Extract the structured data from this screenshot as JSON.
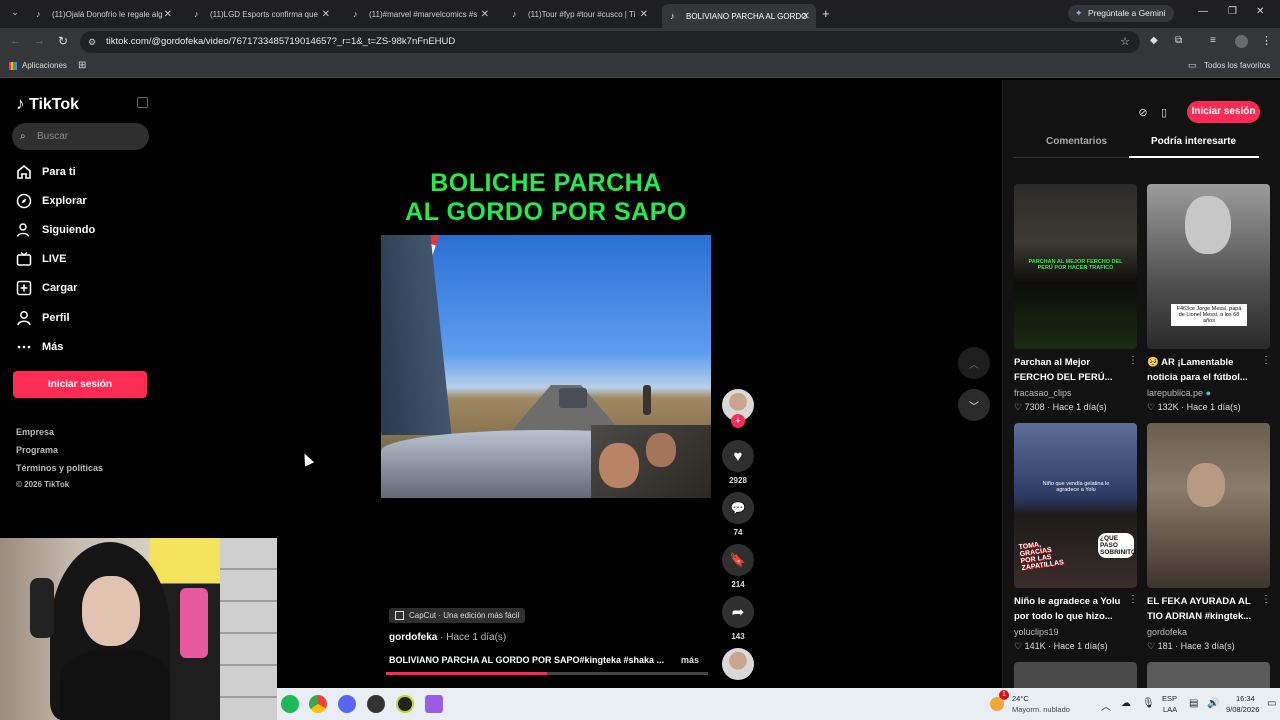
{
  "browser": {
    "tabs": [
      {
        "title": "(11)Ojalá Donofrio le regale alg",
        "active": false
      },
      {
        "title": "(11)LGD Esports confirma que",
        "active": false
      },
      {
        "title": "(11)#marvel #marvelcomics #s",
        "active": false
      },
      {
        "title": "(11)Tour #fyp #tour #cusco | Ti",
        "active": false
      },
      {
        "title": "BOLIVIANO PARCHA AL GORDO",
        "active": true
      }
    ],
    "new_tab": "+",
    "gemini_button": "Pregúntale a Gemini",
    "url": "tiktok.com/@gordofeka/video/7671733485719014657?_r=1&_t=ZS-98k7nFnEHUD",
    "bookmarks": {
      "apps": "Aplicaciones",
      "all": "Todos los favoritos"
    }
  },
  "sidebar": {
    "logo": "TikTok",
    "search_placeholder": "Buscar",
    "nav": [
      {
        "label": "Para ti",
        "icon": "home-icon"
      },
      {
        "label": "Explorar",
        "icon": "compass-icon"
      },
      {
        "label": "Siguiendo",
        "icon": "following-icon"
      },
      {
        "label": "LIVE",
        "icon": "live-icon"
      },
      {
        "label": "Cargar",
        "icon": "upload-icon"
      },
      {
        "label": "Perfil",
        "icon": "profile-icon"
      },
      {
        "label": "Más",
        "icon": "more-icon"
      }
    ],
    "login": "Iniciar sesión",
    "footer": [
      "Empresa",
      "Programa",
      "Términos y políticas",
      "© 2026 TikTok"
    ]
  },
  "video": {
    "overlay_title_1": "BOLICHE PARCHA",
    "overlay_title_2": "AL GORDO POR SAPO",
    "likes": "2928",
    "comments": "74",
    "saves": "214",
    "shares": "143",
    "capcut_tag": "CapCut · Una edición más fácil",
    "author": "gordofeka",
    "posted": " · Hace 1 día(s)",
    "description": "BOLIVIANO PARCHA AL GORDO POR SAPO#kingteka #shaka ...",
    "more": "más",
    "progress": 0.5
  },
  "right_panel": {
    "login": "Iniciar sesión",
    "tabs": {
      "comments": "Comentarios",
      "related": "Podría interesarte"
    },
    "cards": [
      {
        "thumb_text": "PARCHAN AL MEJOR FERCHO DEL PERÚ POR HACER TRAFICO",
        "title": "Parchan al Mejor FERCHO DEL PERÚ...",
        "user": "fracasao_clips",
        "likes": "♡ 7308",
        "date": "· Hace 1 día(s)"
      },
      {
        "thumb_text": "F463ce Jorge Messi, papá de Lionel Messi, a los 68 años",
        "title": "🥺 AR ¡Lamentable noticia para el fútbol...",
        "user": "larepublica.pe",
        "likes": "♡ 132K",
        "date": "· Hace 1 día(s)"
      },
      {
        "thumb_text": "Niño que vendía gelatina le agradece a Yolu",
        "title": "Niño le agradece a Yolu por todo lo que hizo...",
        "user": "yoluclips19",
        "likes": "♡ 141K",
        "date": "· Hace 1 día(s)"
      },
      {
        "thumb_text": "",
        "title": "EL FEKA AYURADA AL TIO ADRIAN #kingtek...",
        "user": "gordofeka",
        "likes": "♡ 181",
        "date": "· Hace 3 día(s)"
      }
    ],
    "thumb_sub": [
      "TOMA, GRACIAS POR LAS ZAPATILLAS",
      "¿QUE PASO SOBRINITO?"
    ]
  },
  "taskbar": {
    "weather_temp": "24°C",
    "weather_desc": "Mayorm. nublado",
    "weather_badge": "1",
    "lang": "ESP",
    "lang2": "LAA",
    "time": "16:34",
    "date": "9/08/2026"
  }
}
